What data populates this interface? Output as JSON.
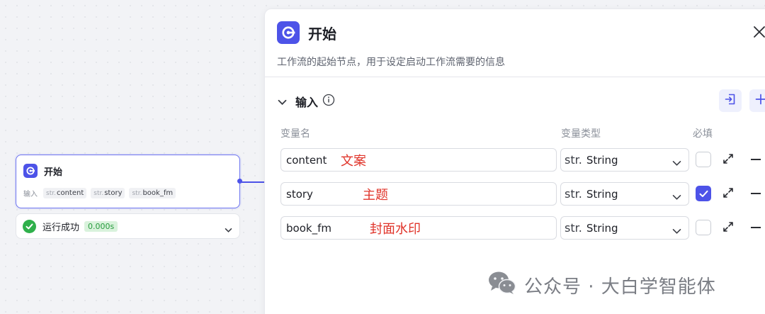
{
  "canvas": {
    "node": {
      "title": "开始",
      "inputs_label": "输入",
      "chips": [
        {
          "type": "str.",
          "name": "content"
        },
        {
          "type": "str.",
          "name": "story"
        },
        {
          "type": "str.",
          "name": "book_fm"
        }
      ]
    },
    "run_status": {
      "text": "运行成功",
      "time": "0.000s"
    }
  },
  "panel": {
    "title": "开始",
    "description": "工作流的起始节点，用于设定启动工作流需要的信息",
    "section": {
      "title": "输入",
      "columns": {
        "name": "变量名",
        "type": "变量类型",
        "required": "必填"
      },
      "rows": [
        {
          "name": "content",
          "annotation": "文案",
          "type_prefix": "str.",
          "type": "String",
          "required": false
        },
        {
          "name": "story",
          "annotation": "主题",
          "type_prefix": "str.",
          "type": "String",
          "required": true
        },
        {
          "name": "book_fm",
          "annotation": "封面水印",
          "type_prefix": "str.",
          "type": "String",
          "required": false
        }
      ]
    }
  },
  "watermark": {
    "text": "公众号 · 大白学智能体"
  },
  "colors": {
    "accent": "#4d53e8",
    "success": "#2fb04b",
    "annotation": "#e0342a"
  }
}
